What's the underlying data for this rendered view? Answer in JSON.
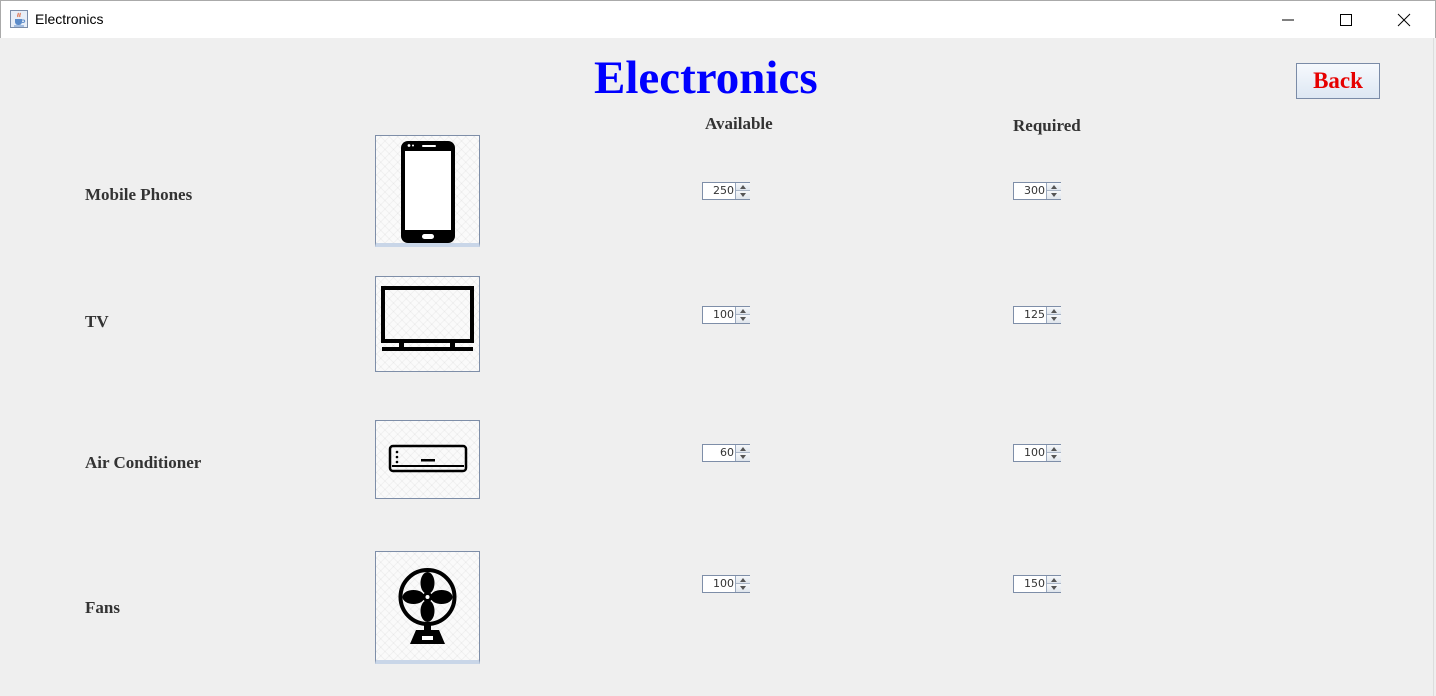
{
  "window": {
    "title": "Electronics",
    "icon": "java-cup-icon"
  },
  "header": {
    "title": "Electronics",
    "title_color": "#0000ff",
    "back_label": "Back",
    "back_color": "#e60000"
  },
  "columns": {
    "available": "Available",
    "required": "Required"
  },
  "items": [
    {
      "label": "Mobile Phones",
      "icon": "mobile-phone-icon",
      "available": "250",
      "required": "300"
    },
    {
      "label": "TV",
      "icon": "tv-icon",
      "available": "100",
      "required": "125"
    },
    {
      "label": "Air Conditioner",
      "icon": "air-conditioner-icon",
      "available": "60",
      "required": "100"
    },
    {
      "label": "Fans",
      "icon": "fan-icon",
      "available": "100",
      "required": "150"
    }
  ]
}
